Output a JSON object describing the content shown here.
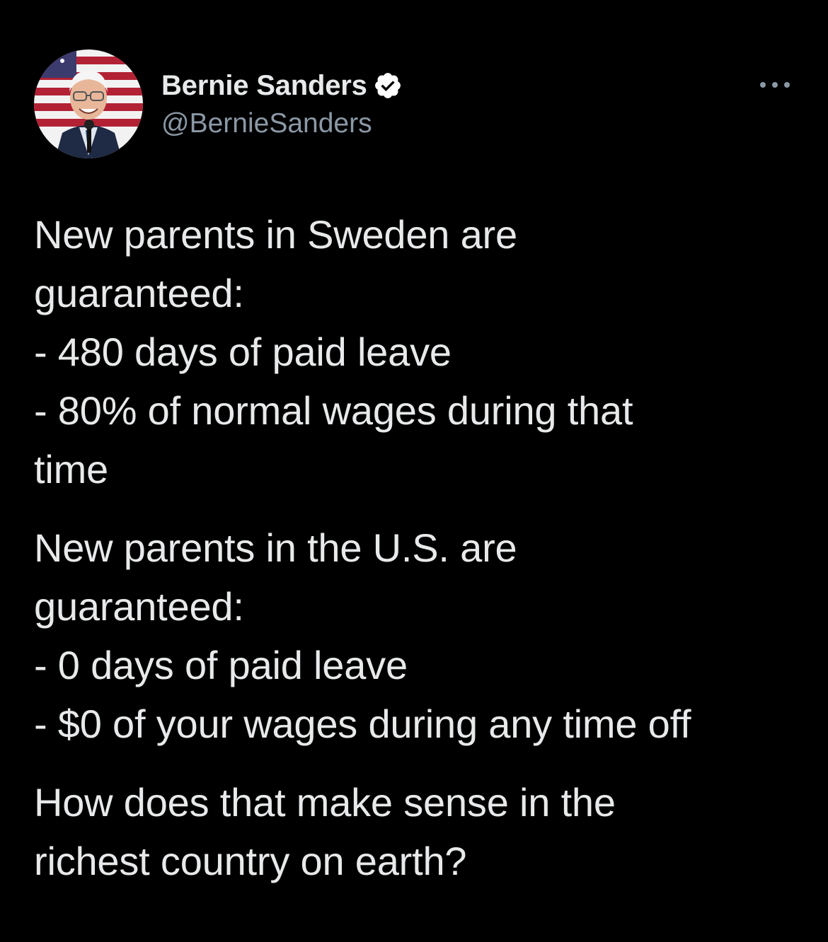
{
  "tweet": {
    "author": {
      "display_name": "Bernie Sanders",
      "handle": "@BernieSanders",
      "verified": true,
      "avatar_icon": "profile-photo"
    },
    "more_icon": "more-dots-icon",
    "body": {
      "paragraphs": [
        {
          "lines": [
            "New parents in Sweden are",
            "guaranteed:",
            "- 480 days of paid leave",
            "- 80% of normal wages during that",
            "time"
          ]
        },
        {
          "lines": [
            "New parents in the U.S. are",
            "guaranteed:",
            "- 0 days of paid leave",
            "- $0 of your wages during any time off"
          ]
        },
        {
          "lines": [
            "How does that make sense in the",
            "richest country on earth?"
          ]
        }
      ]
    }
  },
  "colors": {
    "background": "#000000",
    "primary_text": "#e7e9ea",
    "secondary_text": "#8b98a5",
    "verified_badge": "#ffffff"
  }
}
